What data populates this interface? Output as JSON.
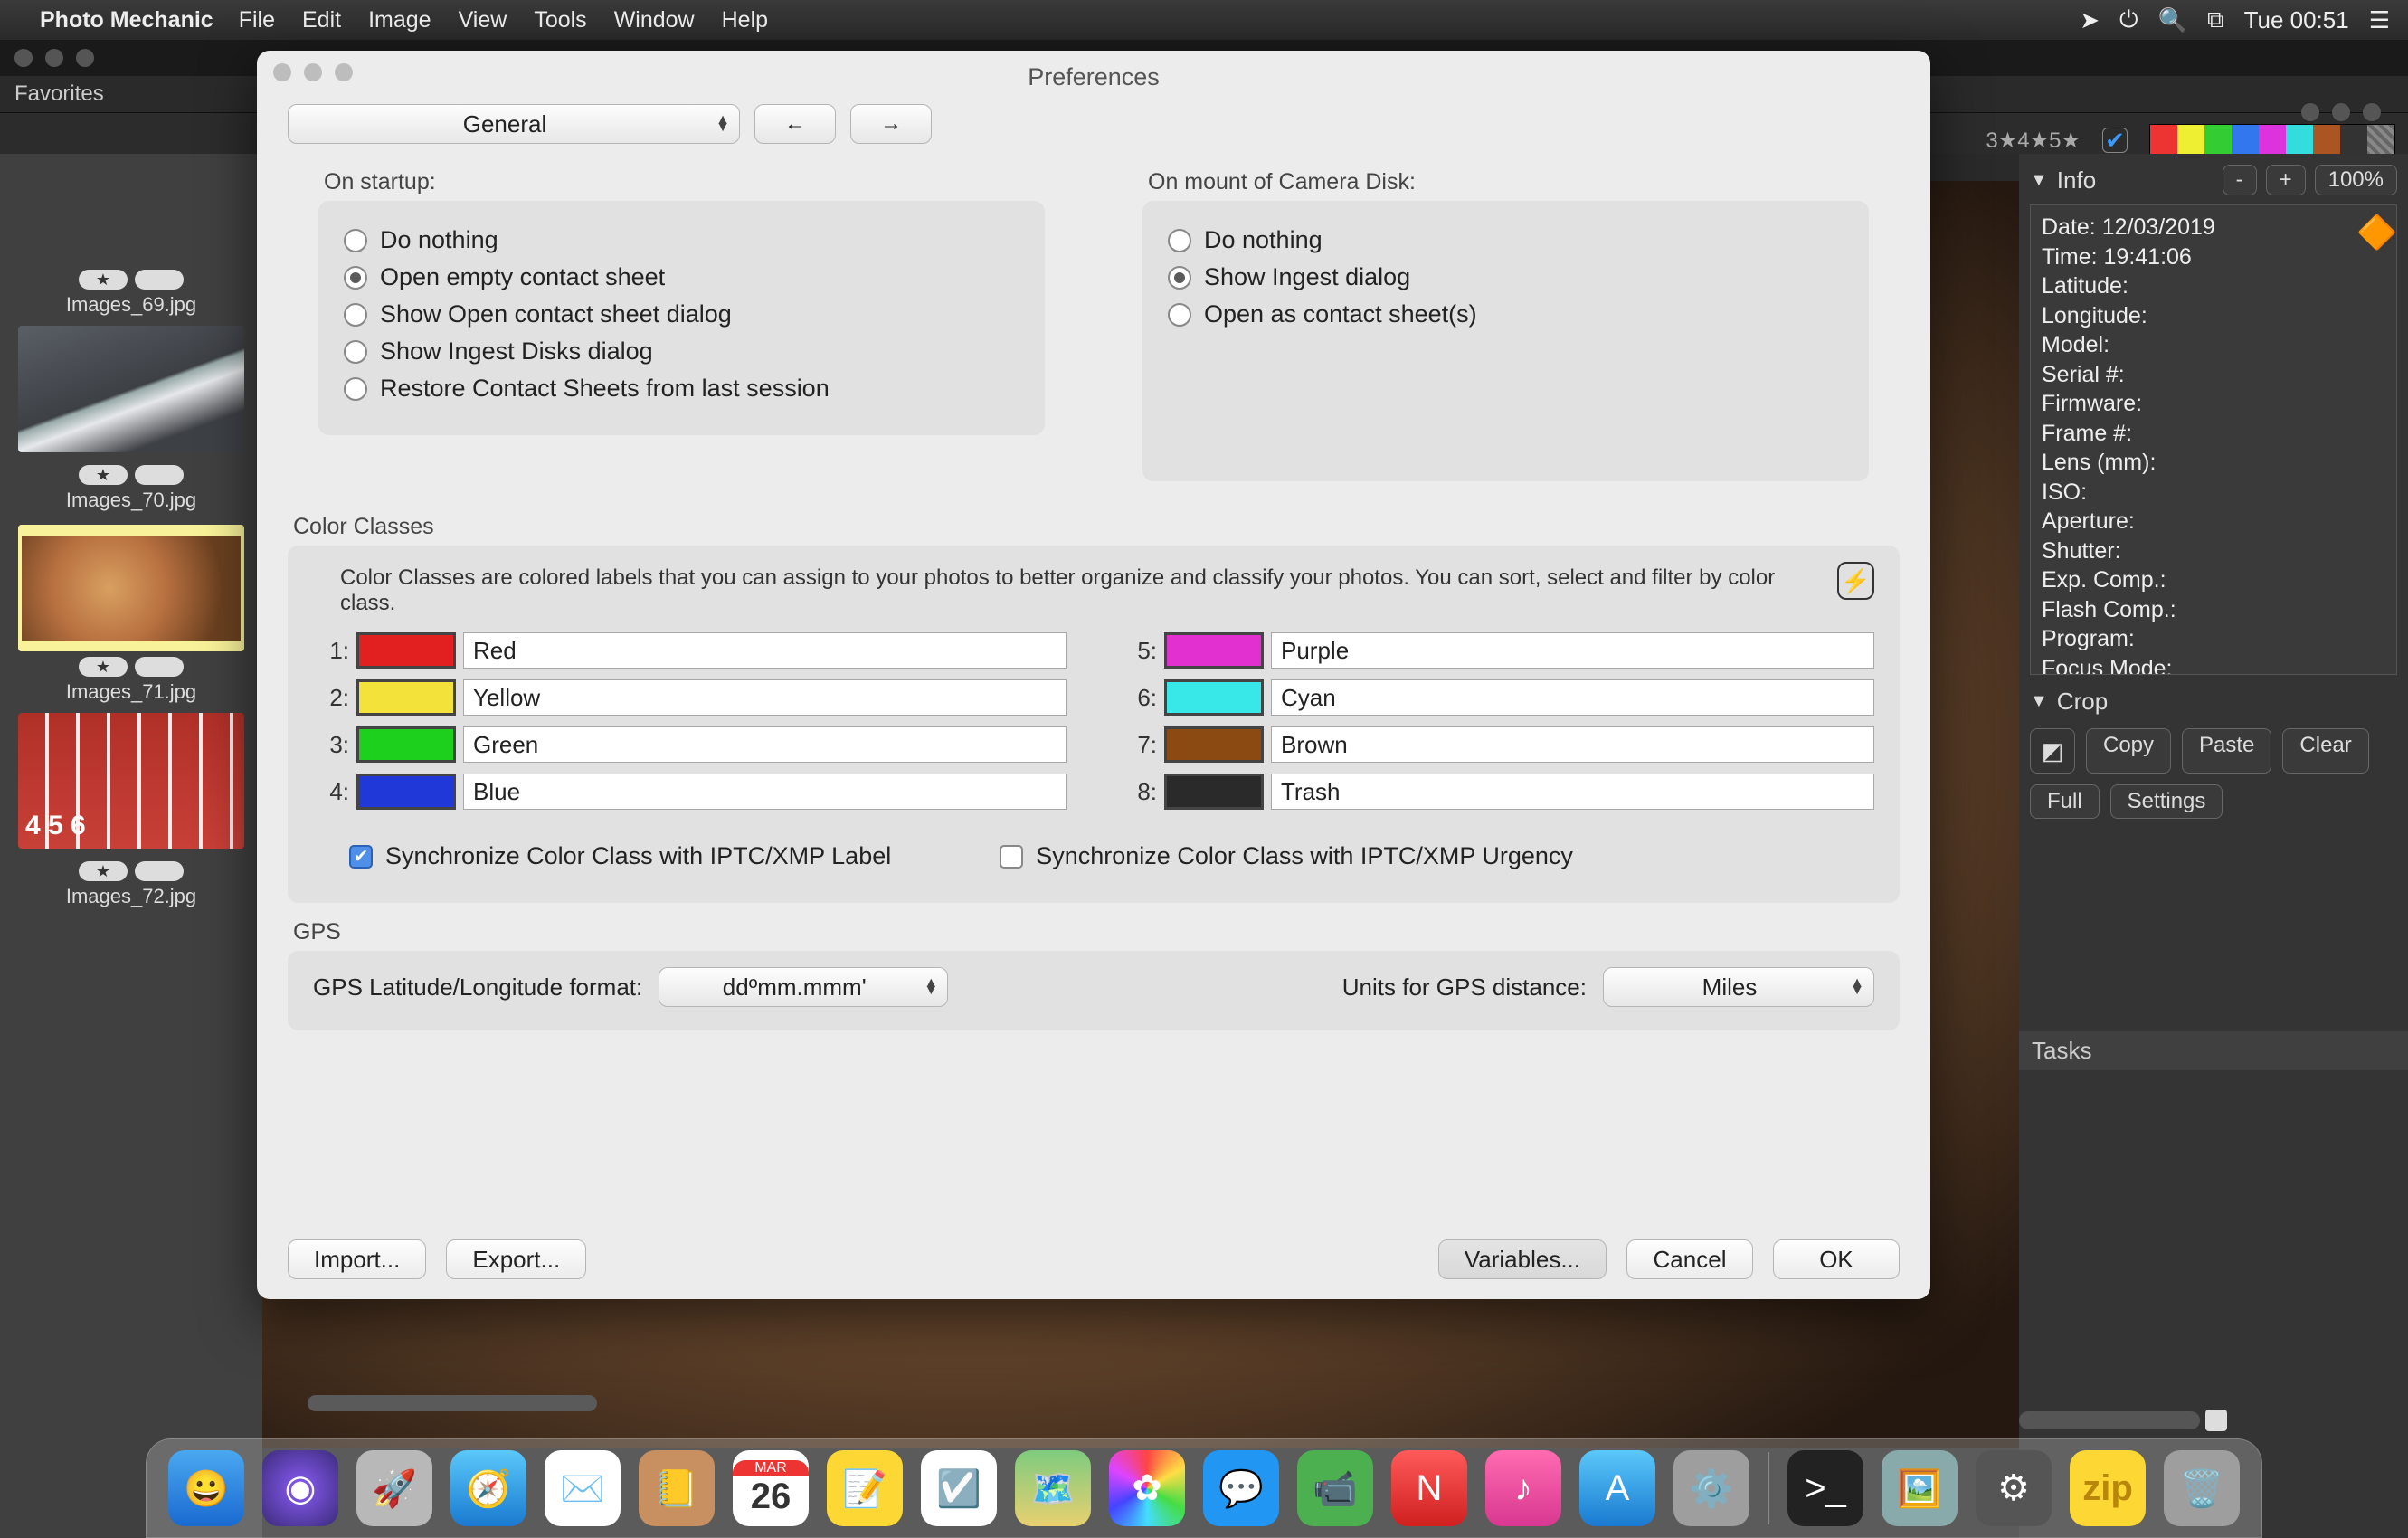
{
  "menubar": {
    "app": "Photo Mechanic",
    "items": [
      "File",
      "Edit",
      "Image",
      "View",
      "Tools",
      "Window",
      "Help"
    ],
    "clock": "Tue 00:51"
  },
  "favorites": "Favorites",
  "sidebar": [
    {
      "label": "Images_69.jpg"
    },
    {
      "label": "Images_70.jpg"
    },
    {
      "label": "Images_71.jpg",
      "selected": true
    },
    {
      "label": "Images_72.jpg"
    }
  ],
  "infopanel": {
    "title": "Info",
    "minus": "-",
    "plus": "+",
    "zoom": "100%",
    "rows": [
      "Date: 12/03/2019",
      "Time: 19:41:06",
      "Latitude:",
      "Longitude:",
      "Model:",
      "Serial #:",
      "Firmware:",
      "Frame #:",
      "Lens (mm):",
      "ISO:",
      "Aperture:",
      "Shutter:",
      "Exp. Comp.:",
      "Flash Comp.:",
      "Program:",
      "Focus Mode:"
    ]
  },
  "crop": {
    "title": "Crop",
    "buttons": [
      "Copy",
      "Paste",
      "Clear",
      "Full",
      "Settings"
    ]
  },
  "tasks": "Tasks",
  "ratings": "3★4★5★",
  "color_strip": [
    "#e33",
    "#ee3",
    "#3c3",
    "#37e",
    "#d3d",
    "#3dd",
    "#a52",
    "#333",
    "#777"
  ],
  "dialog": {
    "title": "Preferences",
    "category": "General",
    "startup": {
      "label": "On startup:",
      "options": [
        "Do nothing",
        "Open empty contact sheet",
        "Show Open contact sheet dialog",
        "Show Ingest Disks dialog",
        "Restore Contact Sheets from last session"
      ],
      "selected": 1
    },
    "mount": {
      "label": "On mount of Camera Disk:",
      "options": [
        "Do nothing",
        "Show Ingest dialog",
        "Open as contact sheet(s)"
      ],
      "selected": 1
    },
    "cc": {
      "title": "Color Classes",
      "desc": "Color Classes are colored labels that you can assign to your photos to better organize and classify your photos.  You can sort, select and filter by color class.",
      "left": [
        {
          "n": "1:",
          "c": "#e22020",
          "name": "Red"
        },
        {
          "n": "2:",
          "c": "#f2e23a",
          "name": "Yellow"
        },
        {
          "n": "3:",
          "c": "#1ed01e",
          "name": "Green"
        },
        {
          "n": "4:",
          "c": "#2038d8",
          "name": "Blue"
        }
      ],
      "right": [
        {
          "n": "5:",
          "c": "#e22fd0",
          "name": "Purple"
        },
        {
          "n": "6:",
          "c": "#38e8e8",
          "name": "Cyan"
        },
        {
          "n": "7:",
          "c": "#8a4a12",
          "name": "Brown"
        },
        {
          "n": "8:",
          "c": "#2a2a2a",
          "name": "Trash"
        }
      ],
      "sync_label": "Synchronize Color Class with IPTC/XMP Label",
      "sync_urgency": "Synchronize Color Class with IPTC/XMP Urgency"
    },
    "gps": {
      "title": "GPS",
      "lat_label": "GPS Latitude/Longitude format:",
      "lat_value": "ddºmm.mmm'",
      "units_label": "Units for GPS distance:",
      "units_value": "Miles"
    },
    "buttons": {
      "import": "Import...",
      "export": "Export...",
      "variables": "Variables...",
      "cancel": "Cancel",
      "ok": "OK"
    }
  },
  "dock": [
    "finder",
    "siri",
    "launchpad",
    "safari",
    "mail",
    "contacts",
    "calendar",
    "notes",
    "reminders",
    "maps",
    "photos",
    "messages",
    "facetime",
    "news",
    "music",
    "appstore",
    "sysprefs",
    "|",
    "terminal",
    "preview",
    "pm",
    "zip",
    "trash"
  ],
  "dock_cal": {
    "month": "MAR",
    "day": "26"
  }
}
